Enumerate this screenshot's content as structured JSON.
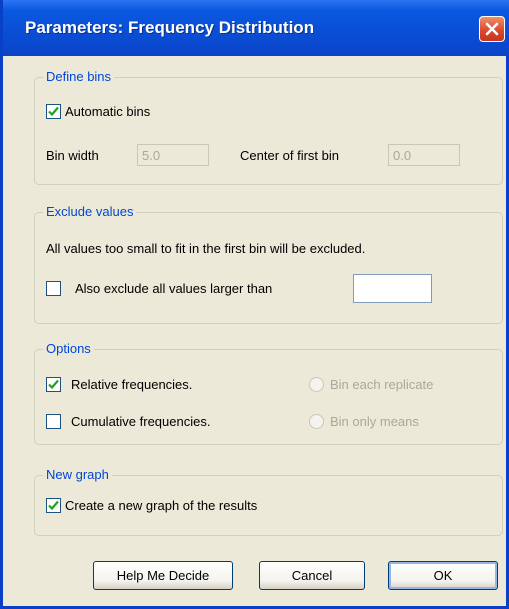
{
  "window": {
    "title": "Parameters: Frequency Distribution",
    "close_icon": "close-icon"
  },
  "define_bins": {
    "legend": "Define bins",
    "automatic_label": "Automatic bins",
    "automatic_checked": true,
    "bin_width_label": "Bin width",
    "bin_width_value": "5.0",
    "center_first_label": "Center of first bin",
    "center_first_value": "0.0"
  },
  "exclude_values": {
    "legend": "Exclude values",
    "note": "All values too small to fit in the first bin will be excluded.",
    "exclude_larger_label": "Also exclude all values larger than",
    "exclude_larger_checked": false,
    "exclude_larger_value": ""
  },
  "options": {
    "legend": "Options",
    "relative_label": "Relative frequencies.",
    "relative_checked": true,
    "cumulative_label": "Cumulative frequencies.",
    "cumulative_checked": false,
    "bin_each_label": "Bin each replicate",
    "bin_means_label": "Bin only means"
  },
  "new_graph": {
    "legend": "New graph",
    "create_label": "Create a new graph of the results",
    "create_checked": true
  },
  "buttons": {
    "help": "Help Me Decide",
    "cancel": "Cancel",
    "ok": "OK"
  },
  "colors": {
    "titlebar": "#0a4fd6",
    "legend_text": "#0046d5",
    "dialog_bg": "#ece9d8"
  }
}
